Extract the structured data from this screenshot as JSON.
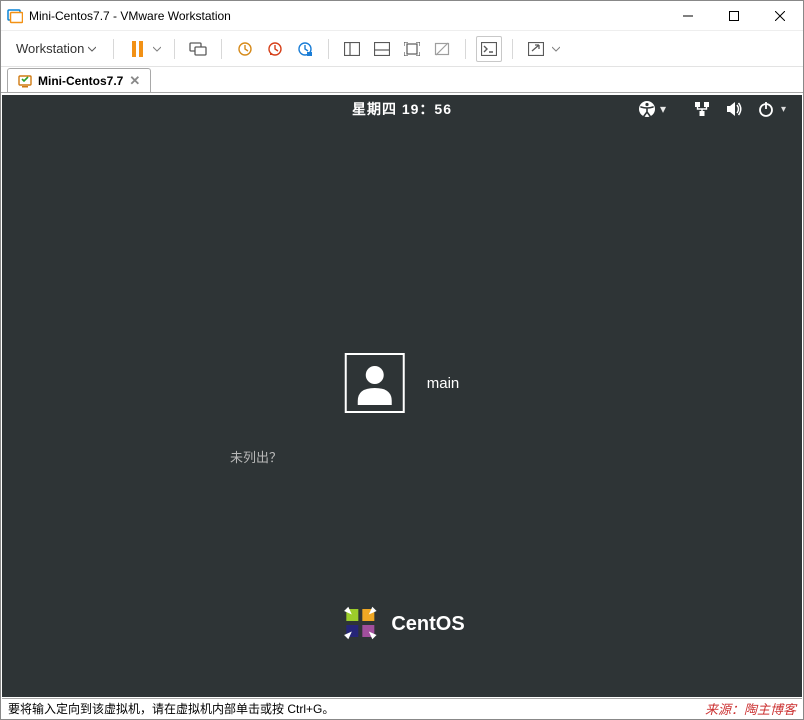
{
  "window": {
    "title": "Mini-Centos7.7 - VMware Workstation"
  },
  "menu": {
    "workstation": "Workstation"
  },
  "tab": {
    "label": "Mini-Centos7.7"
  },
  "guest": {
    "clock": "星期四 19：56",
    "user_name": "main",
    "not_listed": "未列出？",
    "brand": "CentOS"
  },
  "status": {
    "hint": "要将输入定向到该虚拟机，请在虚拟机内部单击或按 Ctrl+G。",
    "watermark": "来源：陶主博客"
  }
}
